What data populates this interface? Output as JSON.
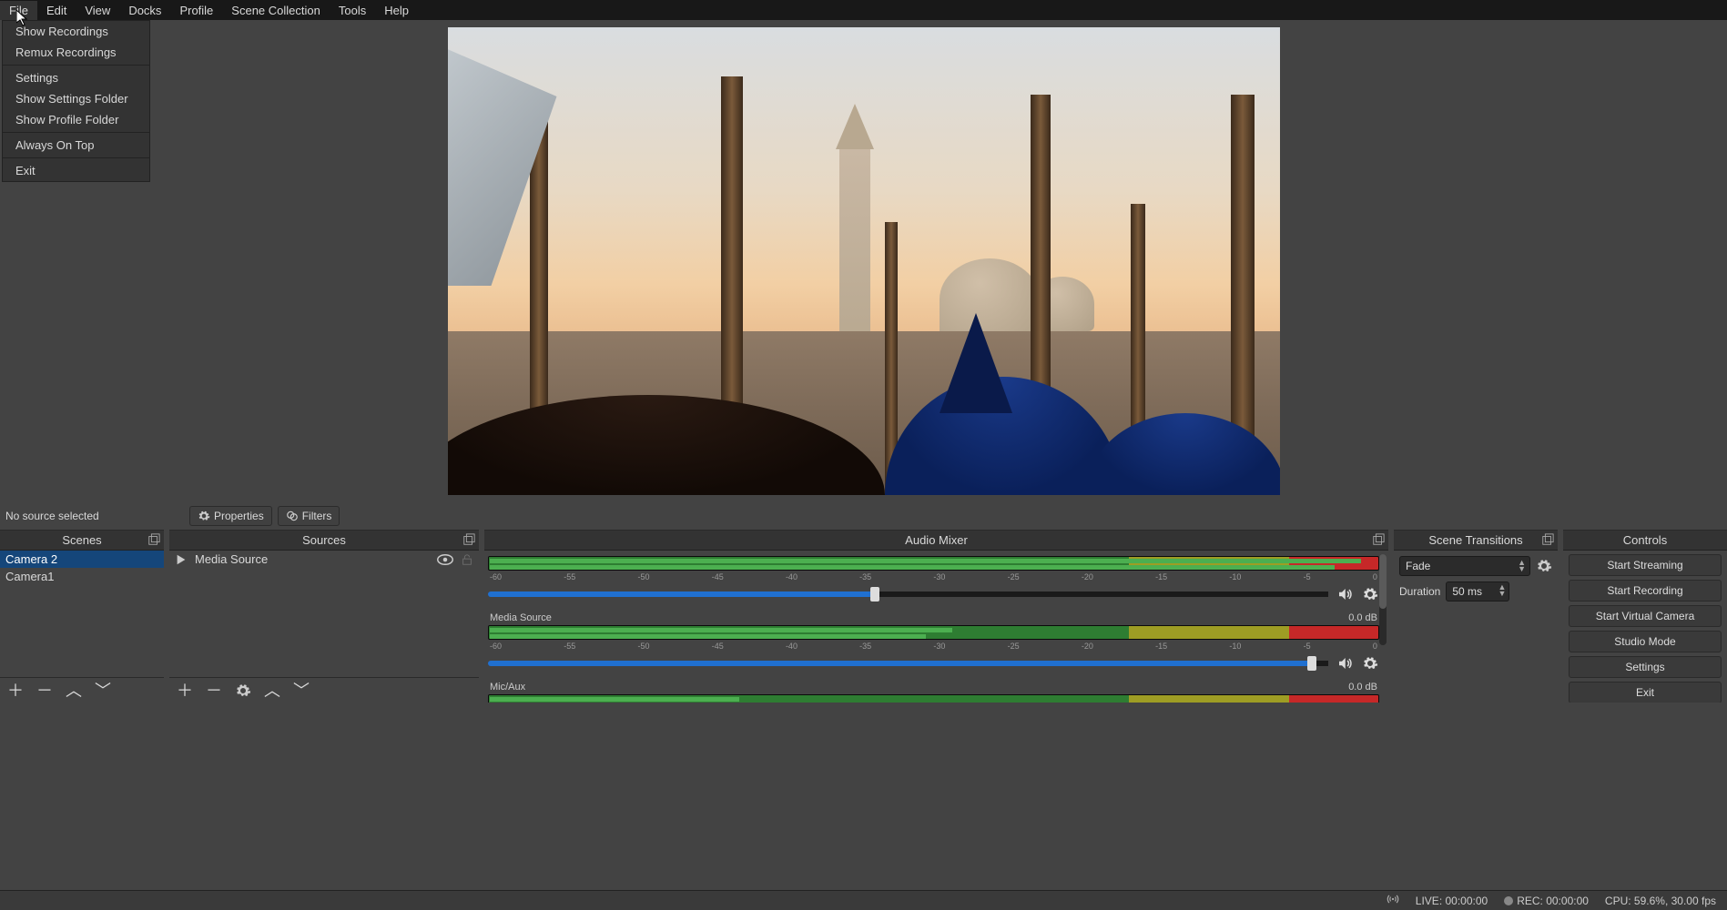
{
  "menubar": [
    "File",
    "Edit",
    "View",
    "Docks",
    "Profile",
    "Scene Collection",
    "Tools",
    "Help"
  ],
  "file_menu": {
    "groups": [
      [
        "Show Recordings",
        "Remux Recordings"
      ],
      [
        "Settings",
        "Show Settings Folder",
        "Show Profile Folder"
      ],
      [
        "Always On Top"
      ],
      [
        "Exit"
      ]
    ]
  },
  "source_toolbar": {
    "no_source": "No source selected",
    "properties": "Properties",
    "filters": "Filters"
  },
  "docks": {
    "scenes": {
      "title": "Scenes",
      "items": [
        "Camera 2",
        "Camera1"
      ],
      "selected": 0
    },
    "sources": {
      "title": "Sources",
      "items": [
        {
          "name": "Media Source",
          "visible": true,
          "locked": false
        }
      ]
    },
    "mixer": {
      "title": "Audio Mixer",
      "ticks": [
        "-60",
        "-55",
        "-50",
        "-45",
        "-40",
        "-35",
        "-30",
        "-25",
        "-20",
        "-15",
        "-10",
        "-5",
        "0"
      ],
      "channels": [
        {
          "name": "",
          "db": "",
          "level_pct": 98,
          "slider_pct": 46
        },
        {
          "name": "Media Source",
          "db": "0.0 dB",
          "level_pct": 52,
          "slider_pct": 98
        },
        {
          "name": "Mic/Aux",
          "db": "0.0 dB",
          "level_pct": 28,
          "slider_pct": 98
        }
      ]
    },
    "transitions": {
      "title": "Scene Transitions",
      "type": "Fade",
      "duration_label": "Duration",
      "duration_value": "50 ms"
    },
    "controls": {
      "title": "Controls",
      "buttons": [
        "Start Streaming",
        "Start Recording",
        "Start Virtual Camera",
        "Studio Mode",
        "Settings",
        "Exit"
      ]
    }
  },
  "statusbar": {
    "live": "LIVE: 00:00:00",
    "rec": "REC: 00:00:00",
    "cpu": "CPU: 59.6%, 30.00 fps"
  }
}
